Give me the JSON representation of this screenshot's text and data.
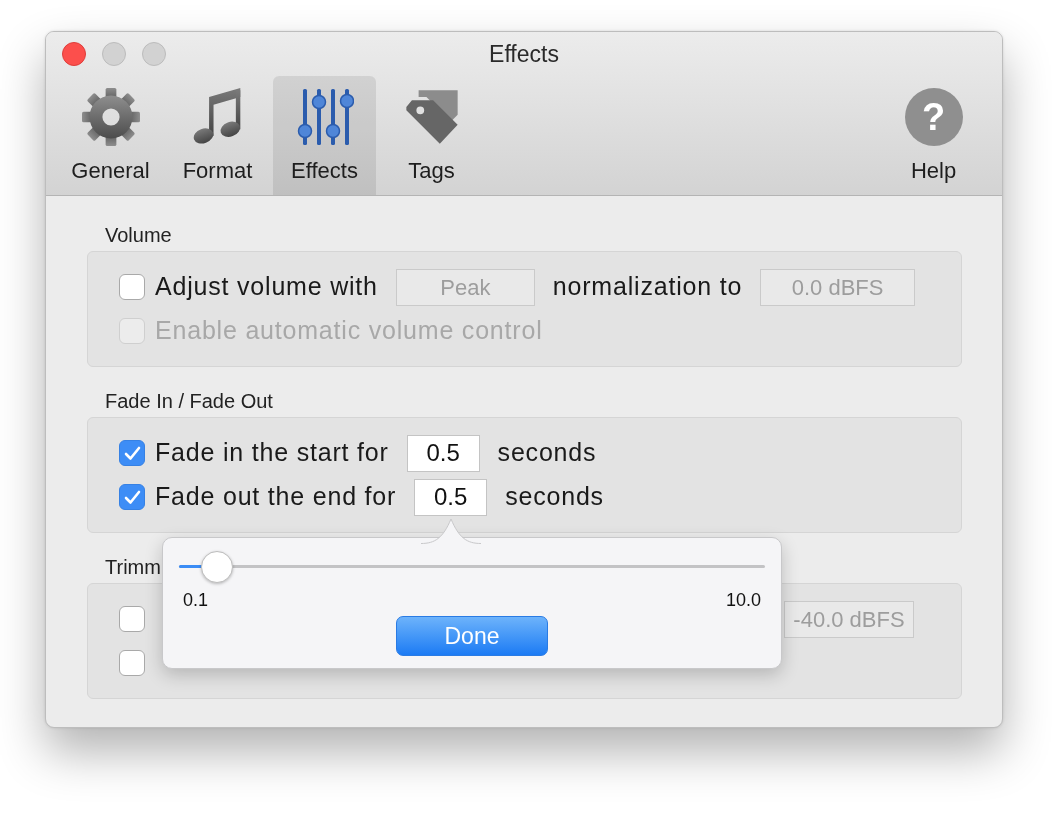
{
  "window": {
    "title": "Effects",
    "buttons": [
      {
        "kind": "close",
        "disabled": false
      },
      {
        "kind": "minimize",
        "disabled": true
      },
      {
        "kind": "zoom",
        "disabled": true
      }
    ]
  },
  "toolbar": {
    "tabs": [
      {
        "kind": "gear",
        "label": "General",
        "selected": false
      },
      {
        "kind": "note",
        "label": "Format",
        "selected": false
      },
      {
        "kind": "sliders",
        "label": "Effects",
        "selected": true
      },
      {
        "kind": "tag",
        "label": "Tags",
        "selected": false
      }
    ],
    "help": {
      "symbol": "?",
      "label": "Help"
    }
  },
  "sections": [
    {
      "title": "Volume",
      "rows": [
        [
          {
            "kind": "checkbox",
            "label": "Adjust volume with",
            "checked": false,
            "disabled": false
          },
          {
            "kind": "field",
            "value": "Peak",
            "disabled": true,
            "editing": false
          },
          {
            "kind": "text",
            "text": "normalization to"
          },
          {
            "kind": "field",
            "value": "0.0 dBFS",
            "disabled": true,
            "editing": false
          }
        ],
        [
          {
            "kind": "checkbox",
            "label": "Enable automatic volume control",
            "checked": false,
            "disabled": true
          }
        ]
      ]
    },
    {
      "title": "Fade In / Fade Out",
      "rows": [
        [
          {
            "kind": "checkbox",
            "label": "Fade in the start for",
            "checked": true,
            "disabled": false
          },
          {
            "kind": "field",
            "value": "0.5",
            "disabled": false,
            "editing": false
          },
          {
            "kind": "text",
            "text": "seconds"
          }
        ],
        [
          {
            "kind": "checkbox",
            "label": "Fade out the end for",
            "checked": true,
            "disabled": false
          },
          {
            "kind": "field",
            "value": "0.5",
            "disabled": false,
            "editing": true
          },
          {
            "kind": "text",
            "text": "seconds"
          }
        ]
      ]
    },
    {
      "title": "Trimm",
      "rows": [
        [
          {
            "kind": "checkbox",
            "checked": false,
            "disabled": false
          },
          {
            "kind": "field",
            "value": "-40.0 dBFS",
            "disabled": true,
            "editing": false
          }
        ],
        [
          {
            "kind": "checkbox",
            "checked": false,
            "disabled": false
          }
        ]
      ]
    }
  ],
  "popover": {
    "slider": {
      "level": 0.04,
      "min_label": "0.1",
      "max_label": "10.0"
    },
    "button": "Done"
  }
}
